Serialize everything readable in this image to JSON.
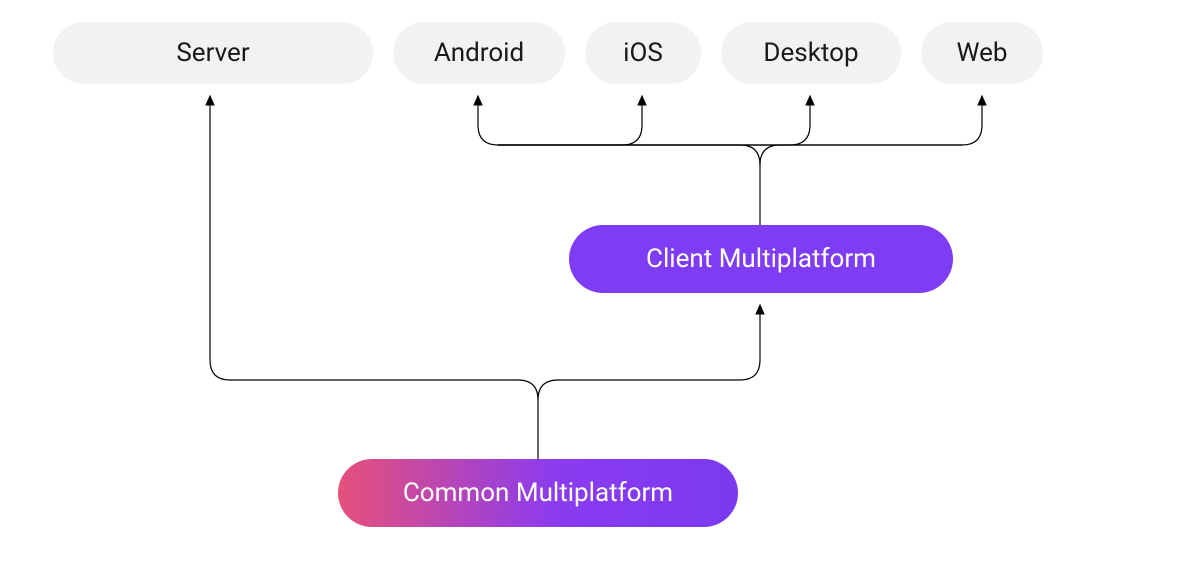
{
  "nodes": {
    "server": "Server",
    "android": "Android",
    "ios": "iOS",
    "desktop": "Desktop",
    "web": "Web",
    "client": "Client Multiplatform",
    "common": "Common Multiplatform"
  },
  "colors": {
    "target_bg": "#f2f2f2",
    "target_text": "#1a1a1a",
    "client_bg": "#7f3cf5",
    "common_gradient_start": "#e6507a",
    "common_gradient_end": "#7b3af0",
    "connector": "#000000"
  }
}
